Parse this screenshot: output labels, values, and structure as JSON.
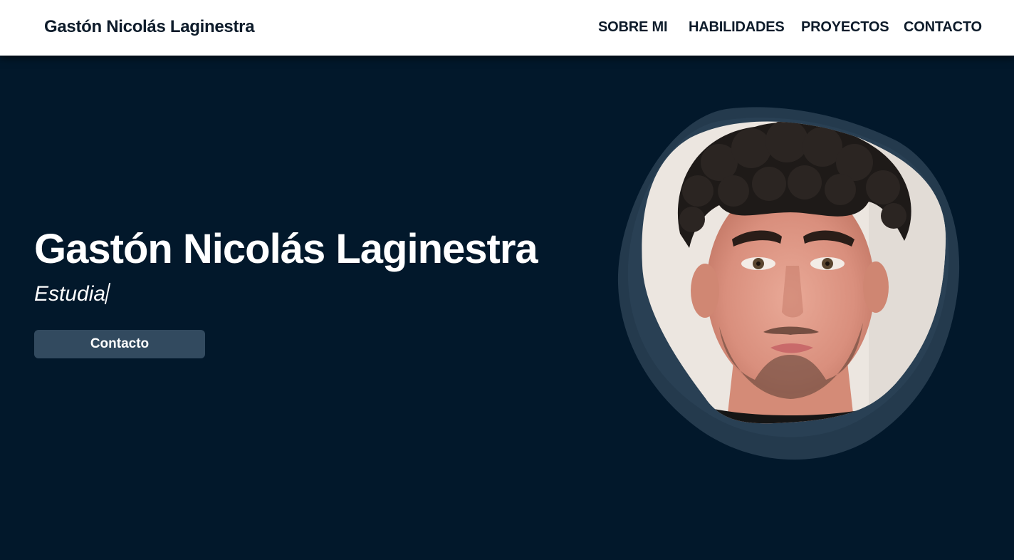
{
  "header": {
    "brand": "Gastón Nicolás Laginestra",
    "nav": [
      {
        "label": "SOBRE MI"
      },
      {
        "label": "HABILIDADES"
      },
      {
        "label": "PROYECTOS"
      },
      {
        "label": "CONTACTO"
      }
    ]
  },
  "hero": {
    "title": "Gastón Nicolás Laginestra",
    "subtitle": "Estudia",
    "cta_label": "Contacto"
  },
  "colors": {
    "navbar_bg": "#ffffff",
    "hero_bg": "#02182b",
    "blob": "#243a4d",
    "button": "#324a5f",
    "text_dark": "#0d1b2a"
  }
}
